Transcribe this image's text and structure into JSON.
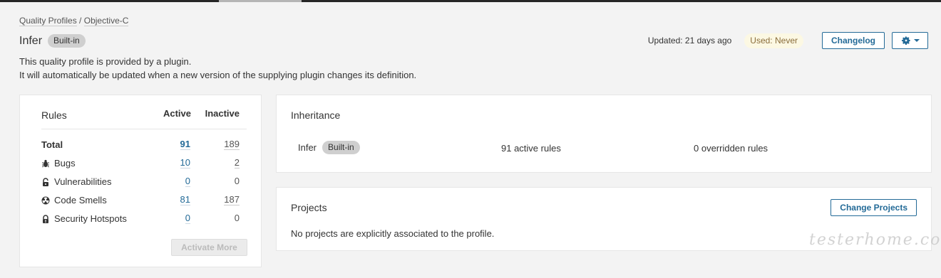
{
  "breadcrumb": {
    "parent": "Quality Profiles",
    "separator": "/",
    "current": "Objective-C"
  },
  "profile": {
    "name": "Infer",
    "badge": "Built-in"
  },
  "description": {
    "line1": "This quality profile is provided by a plugin.",
    "line2": "It will automatically be updated when a new version of the supplying plugin changes its definition."
  },
  "header": {
    "updated": "Updated: 21 days ago",
    "used": "Used: Never",
    "changelog_label": "Changelog"
  },
  "rules": {
    "title": "Rules",
    "active_header": "Active",
    "inactive_header": "Inactive",
    "rows": [
      {
        "label": "Total",
        "active": "91",
        "inactive": "189",
        "icon": null
      },
      {
        "label": "Bugs",
        "active": "10",
        "inactive": "2",
        "icon": "bug-icon"
      },
      {
        "label": "Vulnerabilities",
        "active": "0",
        "inactive": "0",
        "icon": "lock-icon"
      },
      {
        "label": "Code Smells",
        "active": "81",
        "inactive": "187",
        "icon": "radiation-icon"
      },
      {
        "label": "Security Hotspots",
        "active": "0",
        "inactive": "0",
        "icon": "hotspot-icon"
      }
    ],
    "activate_more_label": "Activate More"
  },
  "inheritance": {
    "title": "Inheritance",
    "profile_name": "Infer",
    "badge": "Built-in",
    "active_rules": "91 active rules",
    "overridden_rules": "0 overridden rules"
  },
  "projects": {
    "title": "Projects",
    "change_label": "Change Projects",
    "empty_text": "No projects are explicitly associated to the profile."
  },
  "watermark": "testerhome.com",
  "colors": {
    "link": "#236a97",
    "badge": "#cfcfcf",
    "used_bg": "#fcf8e3",
    "used_text": "#8a6d3b"
  }
}
